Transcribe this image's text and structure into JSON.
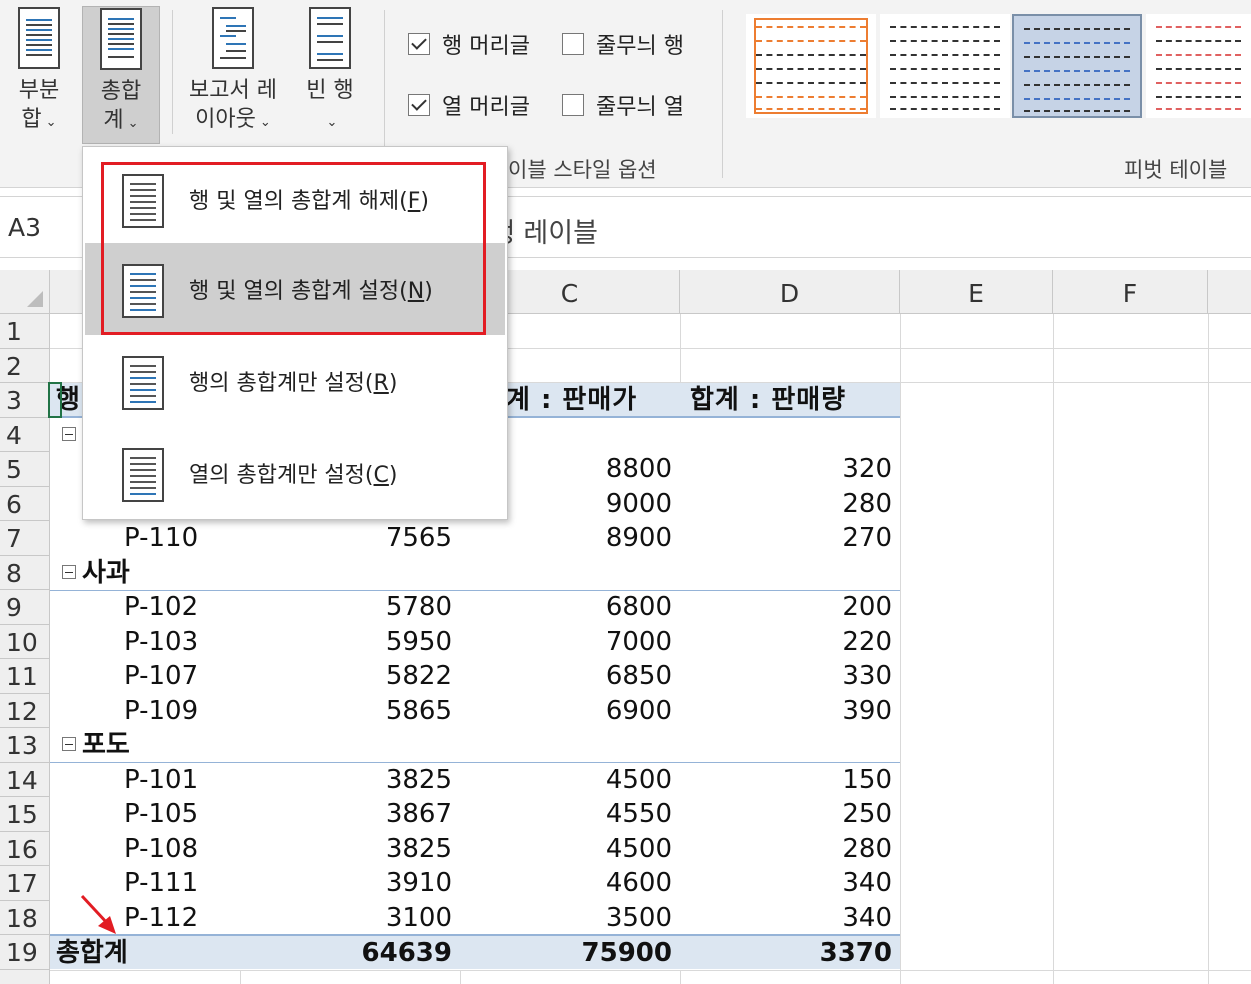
{
  "ribbon": {
    "subtotal": {
      "line1": "부분",
      "line2": "합"
    },
    "grand_total": {
      "line1": "총합",
      "line2": "계"
    },
    "report_layout": {
      "line1": "보고서 레",
      "line2": "이아웃"
    },
    "blank_rows": {
      "line1": "빈 행",
      "line2": ""
    },
    "options": {
      "row_headers": "행 머리글",
      "col_headers": "열 머리글",
      "banded_rows": "줄무늬 행",
      "banded_cols": "줄무늬 열",
      "row_headers_checked": true,
      "col_headers_checked": true,
      "banded_rows_checked": false,
      "banded_cols_checked": false
    },
    "style_options_label": "이블 스타일 옵션",
    "pivot_styles_label": "피벗 테이블"
  },
  "formula_bar": {
    "cell_ref": "A3",
    "content": "행 레이블"
  },
  "columns": [
    "C",
    "D",
    "E",
    "F"
  ],
  "rows": [
    "1",
    "2",
    "3",
    "4",
    "5",
    "6",
    "7",
    "8",
    "9",
    "10",
    "11",
    "12",
    "13",
    "14",
    "15",
    "16",
    "17",
    "18",
    "19"
  ],
  "dropdown": {
    "items": [
      {
        "text": "행 및 열의 총합계 해제",
        "key": "F"
      },
      {
        "text": "행 및 열의 총합계 설정",
        "key": "N"
      },
      {
        "text": "행의 총합계만 설정",
        "key": "R"
      },
      {
        "text": "열의 총합계만 설정",
        "key": "C"
      }
    ]
  },
  "pivot": {
    "header_row": {
      "a": "행",
      "c": "계 : 판매가",
      "d": "합계 : 판매량"
    },
    "row7": {
      "a": "P-110",
      "b": "7565",
      "c": "8900",
      "d": "270"
    },
    "row5": {
      "c": "8800",
      "d": "320"
    },
    "row6": {
      "c": "9000",
      "d": "280"
    },
    "group_apple": "사과",
    "apple": [
      {
        "a": "P-102",
        "b": "5780",
        "c": "6800",
        "d": "200"
      },
      {
        "a": "P-103",
        "b": "5950",
        "c": "7000",
        "d": "220"
      },
      {
        "a": "P-107",
        "b": "5822",
        "c": "6850",
        "d": "330"
      },
      {
        "a": "P-109",
        "b": "5865",
        "c": "6900",
        "d": "390"
      }
    ],
    "group_grape": "포도",
    "grape": [
      {
        "a": "P-101",
        "b": "3825",
        "c": "4500",
        "d": "150"
      },
      {
        "a": "P-105",
        "b": "3867",
        "c": "4550",
        "d": "250"
      },
      {
        "a": "P-108",
        "b": "3825",
        "c": "4500",
        "d": "280"
      },
      {
        "a": "P-111",
        "b": "3910",
        "c": "4600",
        "d": "340"
      },
      {
        "a": "P-112",
        "b": "3100",
        "c": "3500",
        "d": "340"
      }
    ],
    "total": {
      "a": "총합계",
      "b": "64639",
      "c": "75900",
      "d": "3370"
    }
  },
  "colors": {
    "highlight_red": "#e21c23",
    "pivot_band": "#dce6f1",
    "pivot_line": "#95b3d7",
    "selection": "#217346"
  }
}
